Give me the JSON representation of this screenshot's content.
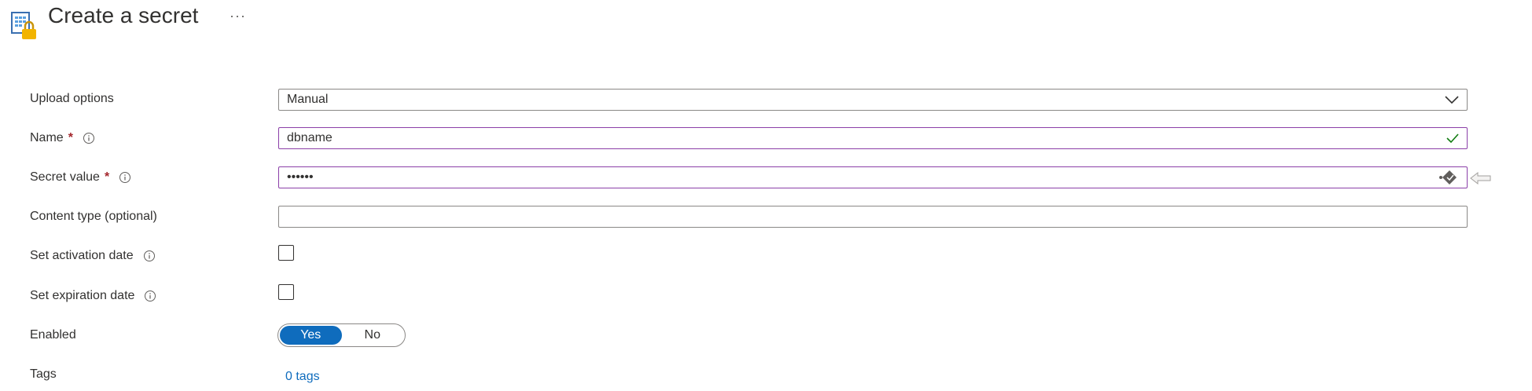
{
  "header": {
    "title": "Create a secret",
    "more_label": "···",
    "icon": "key-vault-secret-icon"
  },
  "form": {
    "upload_options": {
      "label": "Upload options",
      "value": "Manual"
    },
    "name": {
      "label": "Name",
      "required_mark": "*",
      "value": "dbname"
    },
    "secret_value": {
      "label": "Secret value",
      "required_mark": "*",
      "value": "••••••"
    },
    "content_type": {
      "label": "Content type (optional)",
      "value": ""
    },
    "activation_date": {
      "label": "Set activation date",
      "checked": false
    },
    "expiration_date": {
      "label": "Set expiration date",
      "checked": false
    },
    "enabled": {
      "label": "Enabled",
      "options": [
        "Yes",
        "No"
      ],
      "selected": "Yes"
    },
    "tags": {
      "label": "Tags",
      "value": "0 tags"
    }
  },
  "colors": {
    "accent": "#0f6cbd",
    "valid_border": "#8b3fa8",
    "check": "#107c10",
    "required": "#a4262c"
  }
}
